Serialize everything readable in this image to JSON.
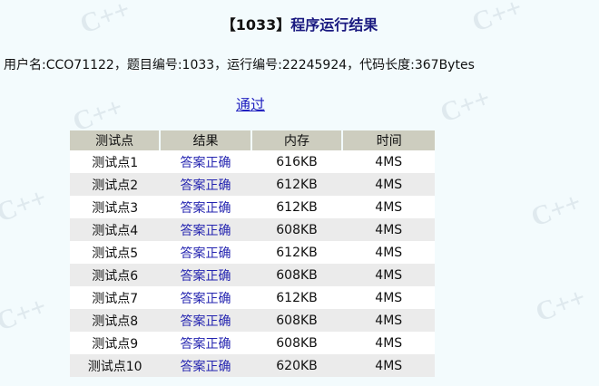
{
  "title": {
    "problem_id": "【1033】",
    "text": "程序运行结果"
  },
  "info": {
    "line": "用户名:CCO71122，题目编号:1033，运行编号:22245924，代码长度:367Bytes"
  },
  "status": {
    "label": "通过"
  },
  "watermark": {
    "text": "C++"
  },
  "table": {
    "headers": [
      "测试点",
      "结果",
      "内存",
      "时间"
    ],
    "rows": [
      {
        "point": "测试点1",
        "result": "答案正确",
        "memory": "616KB",
        "time": "4MS"
      },
      {
        "point": "测试点2",
        "result": "答案正确",
        "memory": "612KB",
        "time": "4MS"
      },
      {
        "point": "测试点3",
        "result": "答案正确",
        "memory": "612KB",
        "time": "4MS"
      },
      {
        "point": "测试点4",
        "result": "答案正确",
        "memory": "608KB",
        "time": "4MS"
      },
      {
        "point": "测试点5",
        "result": "答案正确",
        "memory": "612KB",
        "time": "4MS"
      },
      {
        "point": "测试点6",
        "result": "答案正确",
        "memory": "608KB",
        "time": "4MS"
      },
      {
        "point": "测试点7",
        "result": "答案正确",
        "memory": "612KB",
        "time": "4MS"
      },
      {
        "point": "测试点8",
        "result": "答案正确",
        "memory": "608KB",
        "time": "4MS"
      },
      {
        "point": "测试点9",
        "result": "答案正确",
        "memory": "608KB",
        "time": "4MS"
      },
      {
        "point": "测试点10",
        "result": "答案正确",
        "memory": "620KB",
        "time": "4MS"
      }
    ]
  },
  "colors": {
    "background": "#f3fbfd",
    "title": "#1a1a80",
    "link": "#2020c0",
    "header_bg": "#cdcdbf",
    "row_alt_bg": "#ebebeb"
  }
}
